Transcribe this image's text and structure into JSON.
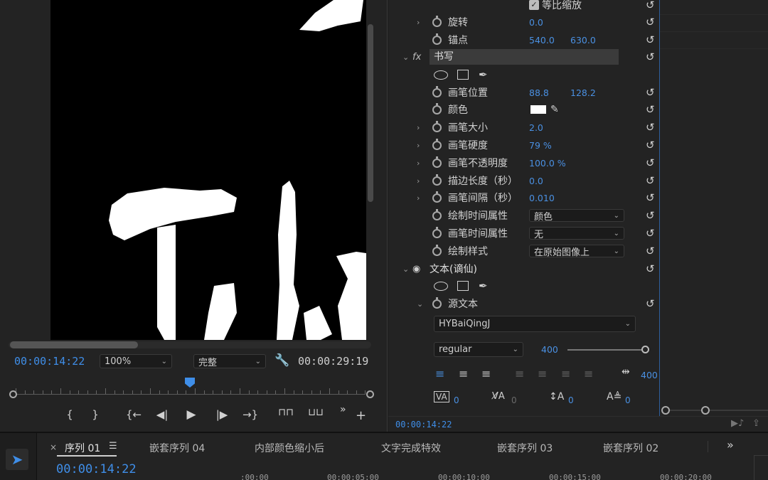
{
  "monitor": {
    "current_time": "00:00:14:22",
    "zoom": "100%",
    "quality": "完整",
    "duration": "00:00:29:19",
    "transport_buttons": [
      "mark-in",
      "mark-out",
      "go-to-in",
      "step-back",
      "play",
      "step-forward",
      "go-to-out",
      "lift",
      "extract",
      "more",
      "add"
    ]
  },
  "effects": {
    "partial_row_label": "等比缩放",
    "rotation": {
      "label": "旋转",
      "value": "0.0"
    },
    "anchor": {
      "label": "锚点",
      "x": "540.0",
      "y": "630.0"
    },
    "write_section": {
      "fx": "fx",
      "title": "书写"
    },
    "brush_position": {
      "label": "画笔位置",
      "x": "88.8",
      "y": "128.2"
    },
    "color": {
      "label": "颜色",
      "swatch": "#ffffff"
    },
    "brush_size": {
      "label": "画笔大小",
      "value": "2.0"
    },
    "brush_hardness": {
      "label": "画笔硬度",
      "value": "79 %"
    },
    "brush_opacity": {
      "label": "画笔不透明度",
      "value": "100.0 %"
    },
    "stroke_length": {
      "label": "描边长度（秒）",
      "value": "0.0"
    },
    "brush_spacing": {
      "label": "画笔间隔（秒）",
      "value": "0.010"
    },
    "paint_time_props": {
      "label": "绘制时间属性",
      "value": "颜色"
    },
    "brush_time_props": {
      "label": "画笔时间属性",
      "value": "无"
    },
    "paint_style": {
      "label": "绘制样式",
      "value": "在原始图像上"
    },
    "text_section": {
      "title": "文本(谪仙)"
    },
    "source_text": {
      "label": "源文本"
    },
    "font": "HYBaiQingJ",
    "font_style": "regular",
    "font_size": "400",
    "tracking": "400",
    "text_metrics": [
      "0",
      "0",
      "0",
      "0"
    ],
    "bottom_time": "00:00:14:22"
  },
  "timeline": {
    "tabs": [
      "序列 01",
      "嵌套序列 04",
      "内部颜色缩小后",
      "文字完成特效",
      "嵌套序列 03",
      "嵌套序列 02"
    ],
    "menu_glyph": "☰",
    "current_time": "00:00:14:22",
    "ruler": [
      ":00:00",
      "00:00:05:00",
      "00:00:10:00",
      "00:00:15:00",
      "00:00:20:00"
    ]
  },
  "colors": {
    "accent": "#3f8ee8",
    "panel": "#232323",
    "viewer_bg": "#000000",
    "value_blue": "#4a90e2"
  }
}
